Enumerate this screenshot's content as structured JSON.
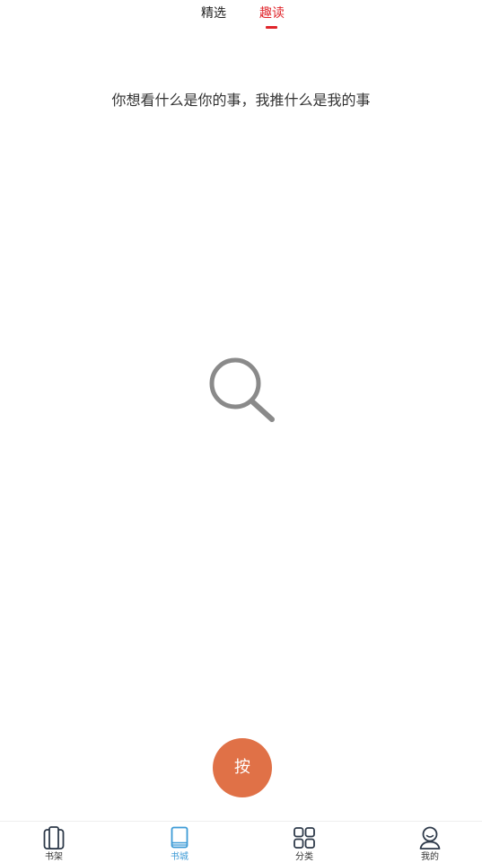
{
  "top_tabs": {
    "featured_label": "精选",
    "fun_read_label": "趣读",
    "active": "趣读",
    "active_color": "#e0252b"
  },
  "main": {
    "slogan": "你想看什么是你的事，我推什么是我的事",
    "center_icon": "search-icon"
  },
  "fab": {
    "label": "按",
    "color": "#e07147"
  },
  "bottom_nav": {
    "active_color": "#3d9bd6",
    "items": [
      {
        "label": "书架",
        "icon": "bookshelf-icon",
        "active": false
      },
      {
        "label": "书城",
        "icon": "book-icon",
        "active": true
      },
      {
        "label": "分类",
        "icon": "grid-icon",
        "active": false
      },
      {
        "label": "我的",
        "icon": "user-icon",
        "active": false
      }
    ]
  }
}
